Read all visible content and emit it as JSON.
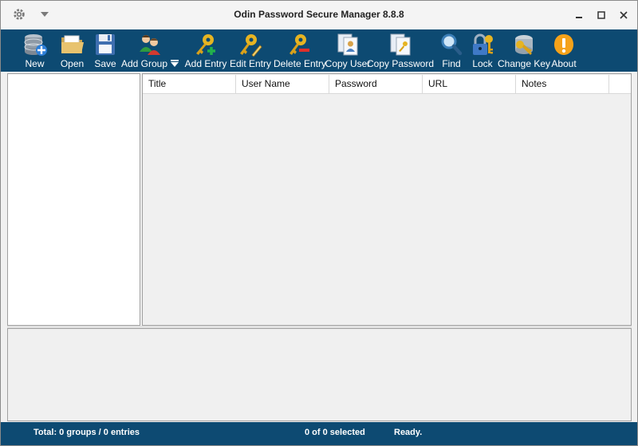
{
  "window": {
    "title": "Odin Password Secure Manager 8.8.8"
  },
  "toolbar": {
    "new": "New",
    "open": "Open",
    "save": "Save",
    "add_group": "Add Group",
    "add_entry": "Add Entry",
    "edit_entry": "Edit Entry",
    "delete_entry": "Delete Entry",
    "copy_user": "Copy User",
    "copy_password": "Copy Password",
    "find": "Find",
    "lock": "Lock",
    "change_key": "Change Key",
    "about": "About"
  },
  "grid": {
    "columns": [
      "Title",
      "User Name",
      "Password",
      "URL",
      "Notes"
    ],
    "rows": []
  },
  "status": {
    "totals": "Total: 0 groups / 0 entries",
    "selection": "0 of 0 selected",
    "state": "Ready."
  },
  "colors": {
    "toolbar_bg": "#0d4a72",
    "statusbar_bg": "#0d4a72"
  },
  "icons": [
    "gear-icon",
    "dropdown-arrow-icon",
    "minimize-icon",
    "maximize-icon",
    "close-icon",
    "database-new-icon",
    "folder-open-icon",
    "floppy-save-icon",
    "users-group-icon",
    "key-add-icon",
    "key-edit-icon",
    "key-delete-icon",
    "copy-user-icon",
    "copy-password-icon",
    "magnifier-icon",
    "lock-icon",
    "change-key-icon",
    "warning-about-icon"
  ]
}
